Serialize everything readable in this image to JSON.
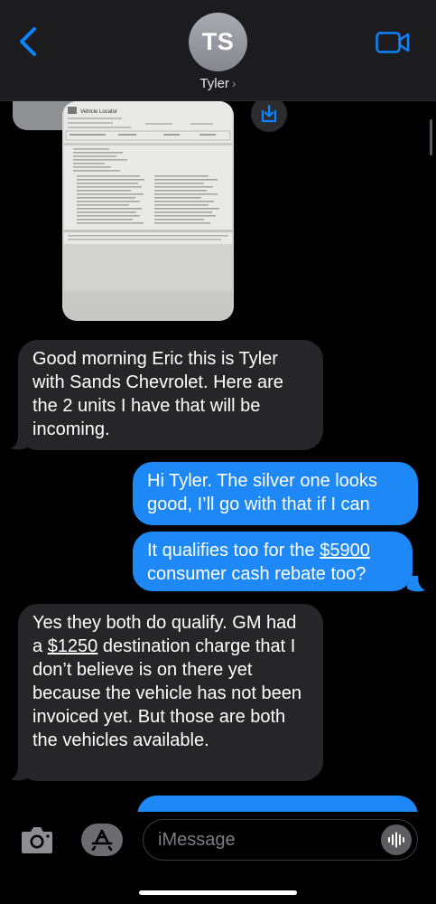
{
  "header": {
    "avatar_initials": "TS",
    "contact_name": "Tyler",
    "chevron": "›"
  },
  "attachment": {
    "doc_title": "Vehicle Locator"
  },
  "messages": [
    {
      "sender": "received",
      "text": "Good morning Eric this is Tyler with Sands Chevrolet. Here are the 2 units I have that will be incoming."
    },
    {
      "sender": "sent",
      "text": "Hi Tyler. The silver one looks good, I’ll go with that if I can"
    },
    {
      "sender": "sent",
      "text_before": "It qualifies too for the ",
      "link": "$5900",
      "text_after": " consumer cash rebate too?"
    },
    {
      "sender": "received",
      "text_before": "Yes they both do qualify. GM had a ",
      "link": "$1250",
      "text_after": " destination charge that I don’t believe is on there yet because the vehicle has not been invoiced yet. But those are both the vehicles available."
    }
  ],
  "composer": {
    "placeholder": "iMessage"
  },
  "icons": {
    "back": "chevron-left-icon",
    "video": "video-camera-icon",
    "save": "download-icon",
    "camera": "camera-icon",
    "apps": "app-store-icon",
    "audio": "waveform-icon"
  },
  "colors": {
    "accent": "#0a84ff",
    "sent_bubble": "#1e88f6",
    "received_bubble": "#262628",
    "header_bg": "#1c1c1e"
  }
}
